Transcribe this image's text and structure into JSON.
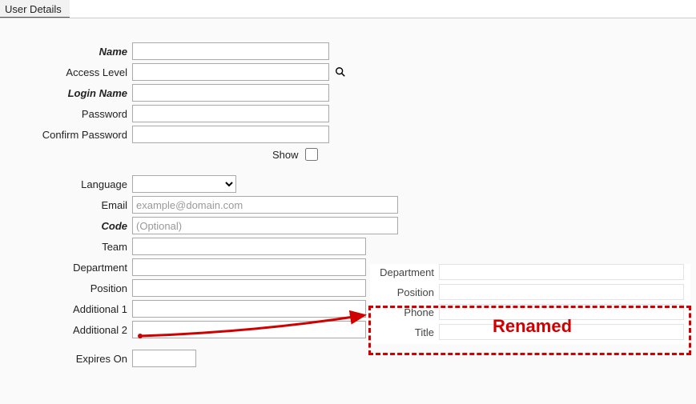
{
  "tab_title": "User Details",
  "labels": {
    "name": "Name",
    "access_level": "Access Level",
    "login_name": "Login Name",
    "password": "Password",
    "confirm_password": "Confirm Password",
    "show": "Show",
    "language": "Language",
    "email": "Email",
    "code": "Code",
    "team": "Team",
    "department": "Department",
    "position": "Position",
    "additional1": "Additional 1",
    "additional2": "Additional 2",
    "expires_on": "Expires On"
  },
  "placeholders": {
    "email": "example@domain.com",
    "code": "(Optional)"
  },
  "overlay": {
    "department": "Department",
    "position": "Position",
    "phone": "Phone",
    "title": "Title"
  },
  "annotation": {
    "renamed": "Renamed"
  },
  "icons": {
    "search": "search"
  }
}
